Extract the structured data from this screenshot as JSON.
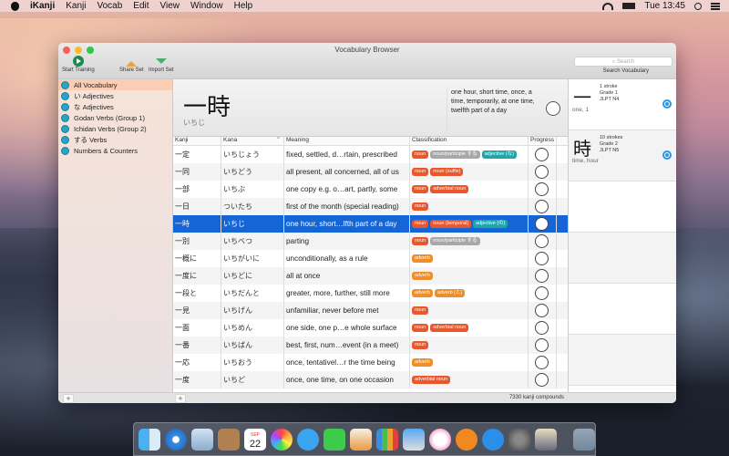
{
  "menubar": {
    "app": "iKanji",
    "items": [
      "Kanji",
      "Vocab",
      "Edit",
      "View",
      "Window",
      "Help"
    ],
    "clock": "Tue 13:45"
  },
  "window": {
    "title": "Vocabulary Browser",
    "toolbar": {
      "start_training": "Start Training",
      "share_set": "Share Set",
      "import_set": "Import Set",
      "search_placeholder": "Search",
      "search_label": "Search Vocabulary"
    }
  },
  "sidebar": {
    "items": [
      {
        "label": "All Vocabulary",
        "selected": true
      },
      {
        "label": "い Adjectives"
      },
      {
        "label": "な Adjectives"
      },
      {
        "label": "Godan Verbs (Group 1)"
      },
      {
        "label": "Ichidan Verbs (Group 2)"
      },
      {
        "label": "する Verbs"
      },
      {
        "label": "Numbers & Counters"
      }
    ],
    "add_label": "+"
  },
  "detail": {
    "kanji": "一時",
    "kana": "いちじ",
    "meaning": "one hour, short time, once, a time, temporarily, at one time, twelfth part of a day"
  },
  "table": {
    "headers": [
      "Kanji",
      "Kana",
      "Meaning",
      "Classification",
      "Progress"
    ],
    "sort_indicator": "^",
    "rows": [
      {
        "kanji": "一定",
        "kana": "いちじょう",
        "meaning": "fixed, settled, d…rtain, prescribed",
        "tags": [
          [
            "noun",
            "noun"
          ],
          [
            "noun/participle する",
            "grey"
          ],
          [
            "adjective (な)",
            "adj"
          ]
        ]
      },
      {
        "kanji": "一同",
        "kana": "いちどう",
        "meaning": "all present, all concerned, all of us",
        "tags": [
          [
            "noun",
            "noun"
          ],
          [
            "noun (suffix)",
            "noun"
          ]
        ]
      },
      {
        "kanji": "一部",
        "kana": "いちぶ",
        "meaning": "one copy e.g. o…art, partly, some",
        "tags": [
          [
            "noun",
            "noun"
          ],
          [
            "adverbial noun",
            "noun"
          ]
        ]
      },
      {
        "kanji": "一日",
        "kana": "ついたち",
        "meaning": "first of the month (special reading)",
        "tags": [
          [
            "noun",
            "noun"
          ]
        ]
      },
      {
        "kanji": "一時",
        "kana": "いちじ",
        "meaning": "one hour, short…lfth part of a day",
        "tags": [
          [
            "noun",
            "noun"
          ],
          [
            "noun (temporal)",
            "noun"
          ],
          [
            "adjective (の)",
            "adj"
          ]
        ],
        "selected": true
      },
      {
        "kanji": "一別",
        "kana": "いちべつ",
        "meaning": "parting",
        "tags": [
          [
            "noun",
            "noun"
          ],
          [
            "noun/participle する",
            "grey"
          ]
        ]
      },
      {
        "kanji": "一概に",
        "kana": "いちがいに",
        "meaning": "unconditionally, as a rule",
        "tags": [
          [
            "adverb",
            "adv"
          ]
        ]
      },
      {
        "kanji": "一度に",
        "kana": "いちどに",
        "meaning": "all at once",
        "tags": [
          [
            "adverb",
            "adv"
          ]
        ]
      },
      {
        "kanji": "一段と",
        "kana": "いちだんと",
        "meaning": "greater, more, further, still more",
        "tags": [
          [
            "adverb",
            "adv"
          ],
          [
            "adverb (と)",
            "adv"
          ]
        ]
      },
      {
        "kanji": "一見",
        "kana": "いちげん",
        "meaning": "unfamiliar, never before met",
        "tags": [
          [
            "noun",
            "noun"
          ]
        ]
      },
      {
        "kanji": "一面",
        "kana": "いちめん",
        "meaning": "one side, one p…e whole surface",
        "tags": [
          [
            "noun",
            "noun"
          ],
          [
            "adverbial noun",
            "noun"
          ]
        ]
      },
      {
        "kanji": "一番",
        "kana": "いちばん",
        "meaning": "best, first, num…event (in a meet)",
        "tags": [
          [
            "noun",
            "noun"
          ]
        ]
      },
      {
        "kanji": "一応",
        "kana": "いちおう",
        "meaning": "once, tentativel…r the time being",
        "tags": [
          [
            "adverb",
            "adv"
          ]
        ]
      },
      {
        "kanji": "一度",
        "kana": "いちど",
        "meaning": "once, one time, on one occasion",
        "tags": [
          [
            "adverbial noun",
            "noun"
          ]
        ]
      }
    ],
    "footer_count": "7330 kanji compounds",
    "add_label": "+"
  },
  "kanji_panel": [
    {
      "kanji": "一",
      "strokes": "1 stroke",
      "grade": "Grade 1",
      "jlpt": "JLPT N4",
      "meaning": "one, 1"
    },
    {
      "kanji": "時",
      "strokes": "10 strokes",
      "grade": "Grade 2",
      "jlpt": "JLPT N5",
      "meaning": "time, hour"
    }
  ],
  "colors": {
    "selection": "#1665d6",
    "tag_noun": "#e9572d",
    "tag_adverb": "#ef8f2c",
    "tag_adjective": "#1fa6a8",
    "tag_participle": "#a8a8a8"
  },
  "dock": {
    "calendar_month": "SEP",
    "calendar_day": "22",
    "apps": [
      "finder-icon",
      "safari-icon",
      "mail-icon",
      "contacts-icon",
      "calendar-icon",
      "photos-icon",
      "messages-icon",
      "facetime-icon",
      "pages-icon",
      "numbers-icon",
      "keynote-icon",
      "itunes-icon",
      "ibooks-icon",
      "app-store-icon",
      "system-preferences-icon",
      "ikanji-icon"
    ]
  }
}
